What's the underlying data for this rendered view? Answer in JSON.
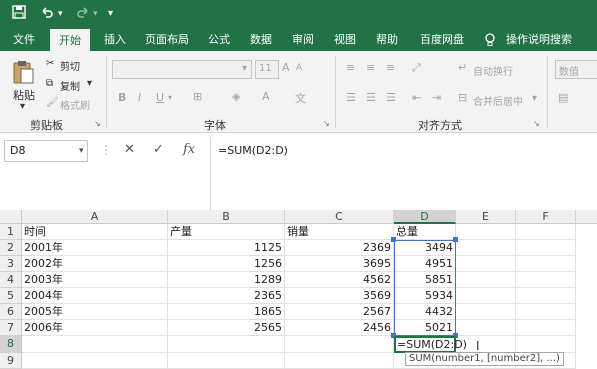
{
  "quick_access": {
    "save_icon": "save-icon",
    "undo_icon": "undo-icon",
    "redo_icon": "redo-icon",
    "customize_icon": "customize-icon"
  },
  "tabs": [
    {
      "label": "文件"
    },
    {
      "label": "开始"
    },
    {
      "label": "插入"
    },
    {
      "label": "页面布局"
    },
    {
      "label": "公式"
    },
    {
      "label": "数据"
    },
    {
      "label": "审阅"
    },
    {
      "label": "视图"
    },
    {
      "label": "帮助"
    },
    {
      "label": "百度网盘"
    }
  ],
  "tell_me": "操作说明搜索",
  "ribbon": {
    "clipboard": {
      "paste": "粘贴",
      "cut": "剪切",
      "copy": "复制",
      "format_painter": "格式刷",
      "group": "剪贴板"
    },
    "font": {
      "size": "11",
      "group": "字体"
    },
    "alignment": {
      "wrap": "自动换行",
      "merge": "合并后居中",
      "group": "对齐方式"
    },
    "number": {
      "format": "数值"
    }
  },
  "formula_bar": {
    "name_box": "D8",
    "formula": "=SUM(D2:D)"
  },
  "columns": [
    "A",
    "B",
    "C",
    "D",
    "E",
    "F"
  ],
  "rows": [
    "1",
    "2",
    "3",
    "4",
    "5",
    "6",
    "7",
    "8",
    "9"
  ],
  "table": {
    "headers": [
      "时间",
      "产量",
      "销量",
      "总量"
    ],
    "data": [
      [
        "2001年",
        "1125",
        "2369",
        "3494"
      ],
      [
        "2002年",
        "1256",
        "3695",
        "4951"
      ],
      [
        "2003年",
        "1289",
        "4562",
        "5851"
      ],
      [
        "2004年",
        "2365",
        "3569",
        "5934"
      ],
      [
        "2005年",
        "1865",
        "2567",
        "4432"
      ],
      [
        "2006年",
        "2565",
        "2456",
        "5021"
      ]
    ]
  },
  "editing_cell": "=SUM(D2:D)",
  "tooltip": "SUM(number1, [number2], ...)",
  "colors": {
    "excel_green": "#217346",
    "range_blue": "#4472c4"
  }
}
